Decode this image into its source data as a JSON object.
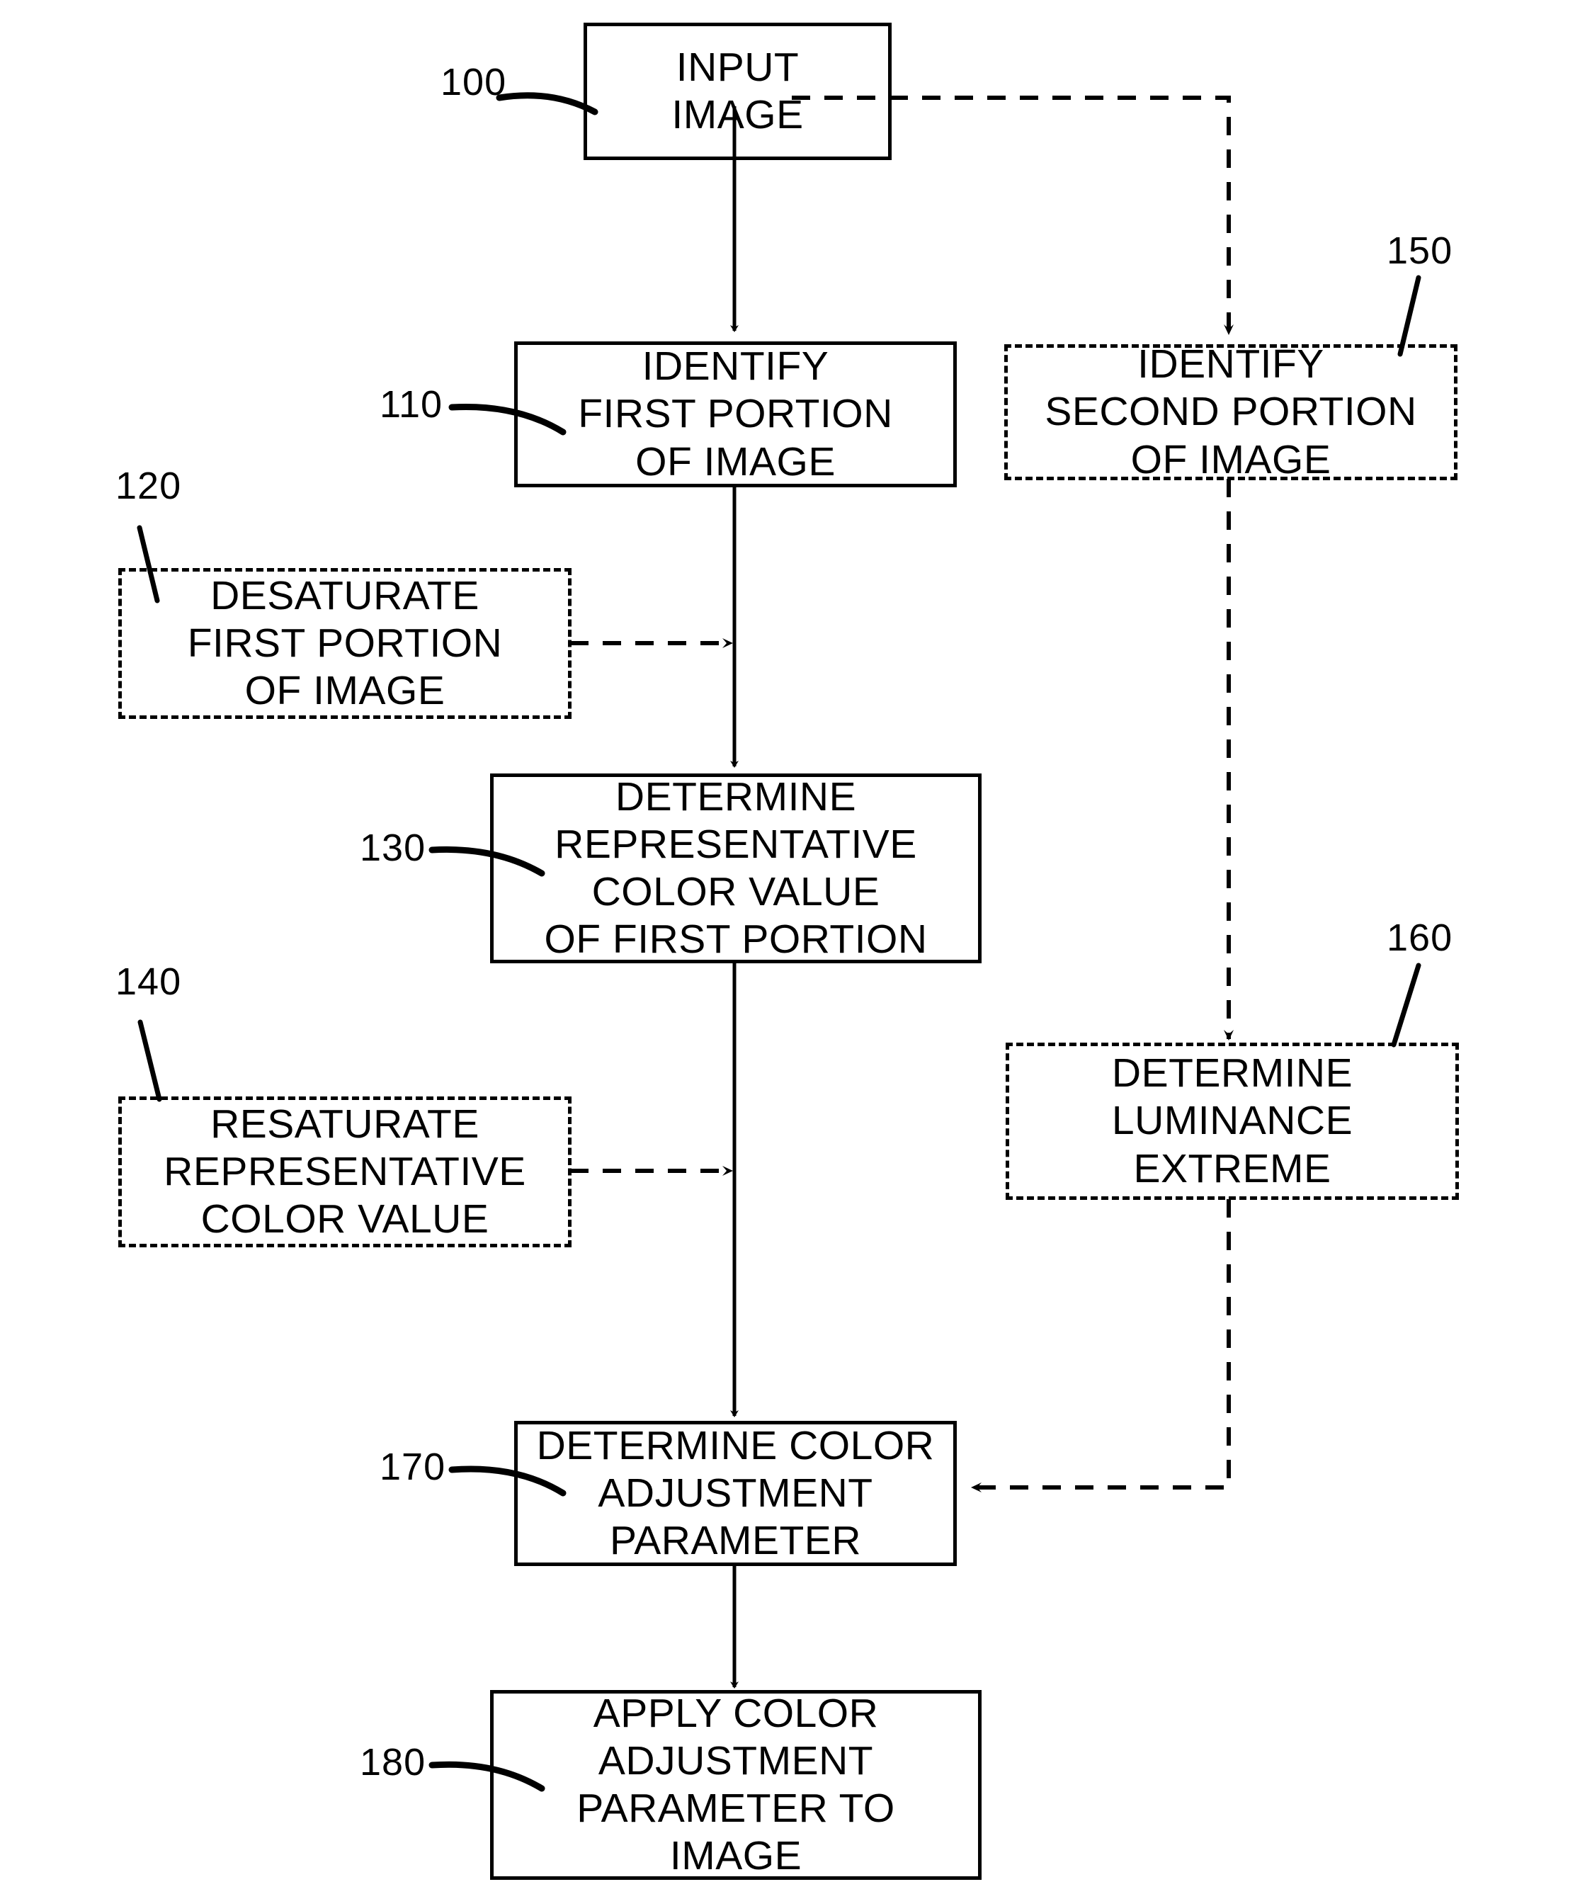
{
  "figure": {
    "type": "patent-flowchart",
    "title": "",
    "background": "#ffffff",
    "stroke": "#000000"
  },
  "nodes": {
    "input_image": {
      "ref": "100",
      "style": "solid",
      "lines": [
        "INPUT",
        "IMAGE"
      ]
    },
    "identify_first_portion": {
      "ref": "110",
      "style": "solid",
      "lines": [
        "IDENTIFY",
        "FIRST PORTION",
        "OF IMAGE"
      ]
    },
    "desaturate_first_portion": {
      "ref": "120",
      "style": "dashed",
      "lines": [
        "DESATURATE",
        "FIRST PORTION",
        "OF IMAGE"
      ]
    },
    "determine_representative_color_value": {
      "ref": "130",
      "style": "solid",
      "lines": [
        "DETERMINE",
        "REPRESENTATIVE",
        "COLOR VALUE",
        "OF FIRST PORTION"
      ]
    },
    "resaturate_representative_color_value": {
      "ref": "140",
      "style": "dashed",
      "lines": [
        "RESATURATE",
        "REPRESENTATIVE",
        "COLOR VALUE"
      ]
    },
    "identify_second_portion": {
      "ref": "150",
      "style": "dashed",
      "lines": [
        "IDENTIFY",
        "SECOND PORTION",
        "OF IMAGE"
      ]
    },
    "determine_luminance_extreme": {
      "ref": "160",
      "style": "dashed",
      "lines": [
        "DETERMINE",
        "LUMINANCE",
        "EXTREME"
      ]
    },
    "determine_color_adjustment_parameter": {
      "ref": "170",
      "style": "solid",
      "lines": [
        "DETERMINE COLOR",
        "ADJUSTMENT",
        "PARAMETER"
      ]
    },
    "apply_color_adjustment_parameter": {
      "ref": "180",
      "style": "solid",
      "lines": [
        "APPLY COLOR",
        "ADJUSTMENT",
        "PARAMETER TO",
        "IMAGE"
      ]
    }
  },
  "reference_numerals": [
    "100",
    "110",
    "120",
    "130",
    "140",
    "150",
    "160",
    "170",
    "180"
  ],
  "connectors": [
    {
      "from": "input_image",
      "to": "identify_first_portion",
      "style": "solid",
      "direction": "down"
    },
    {
      "from": "input_image",
      "to": "identify_second_portion",
      "style": "dashed",
      "direction": "right-down"
    },
    {
      "from": "identify_first_portion",
      "to": "determine_representative_color_value",
      "style": "solid",
      "direction": "down"
    },
    {
      "from": "desaturate_first_portion",
      "to": "main-trunk",
      "style": "dashed",
      "direction": "right"
    },
    {
      "from": "determine_representative_color_value",
      "to": "determine_color_adjustment_parameter",
      "style": "solid",
      "direction": "down"
    },
    {
      "from": "resaturate_representative_color_value",
      "to": "main-trunk",
      "style": "dashed",
      "direction": "right"
    },
    {
      "from": "identify_second_portion",
      "to": "determine_luminance_extreme",
      "style": "dashed",
      "direction": "down"
    },
    {
      "from": "determine_luminance_extreme",
      "to": "determine_color_adjustment_parameter",
      "style": "dashed",
      "direction": "down-left"
    },
    {
      "from": "determine_color_adjustment_parameter",
      "to": "apply_color_adjustment_parameter",
      "style": "solid",
      "direction": "down"
    }
  ]
}
